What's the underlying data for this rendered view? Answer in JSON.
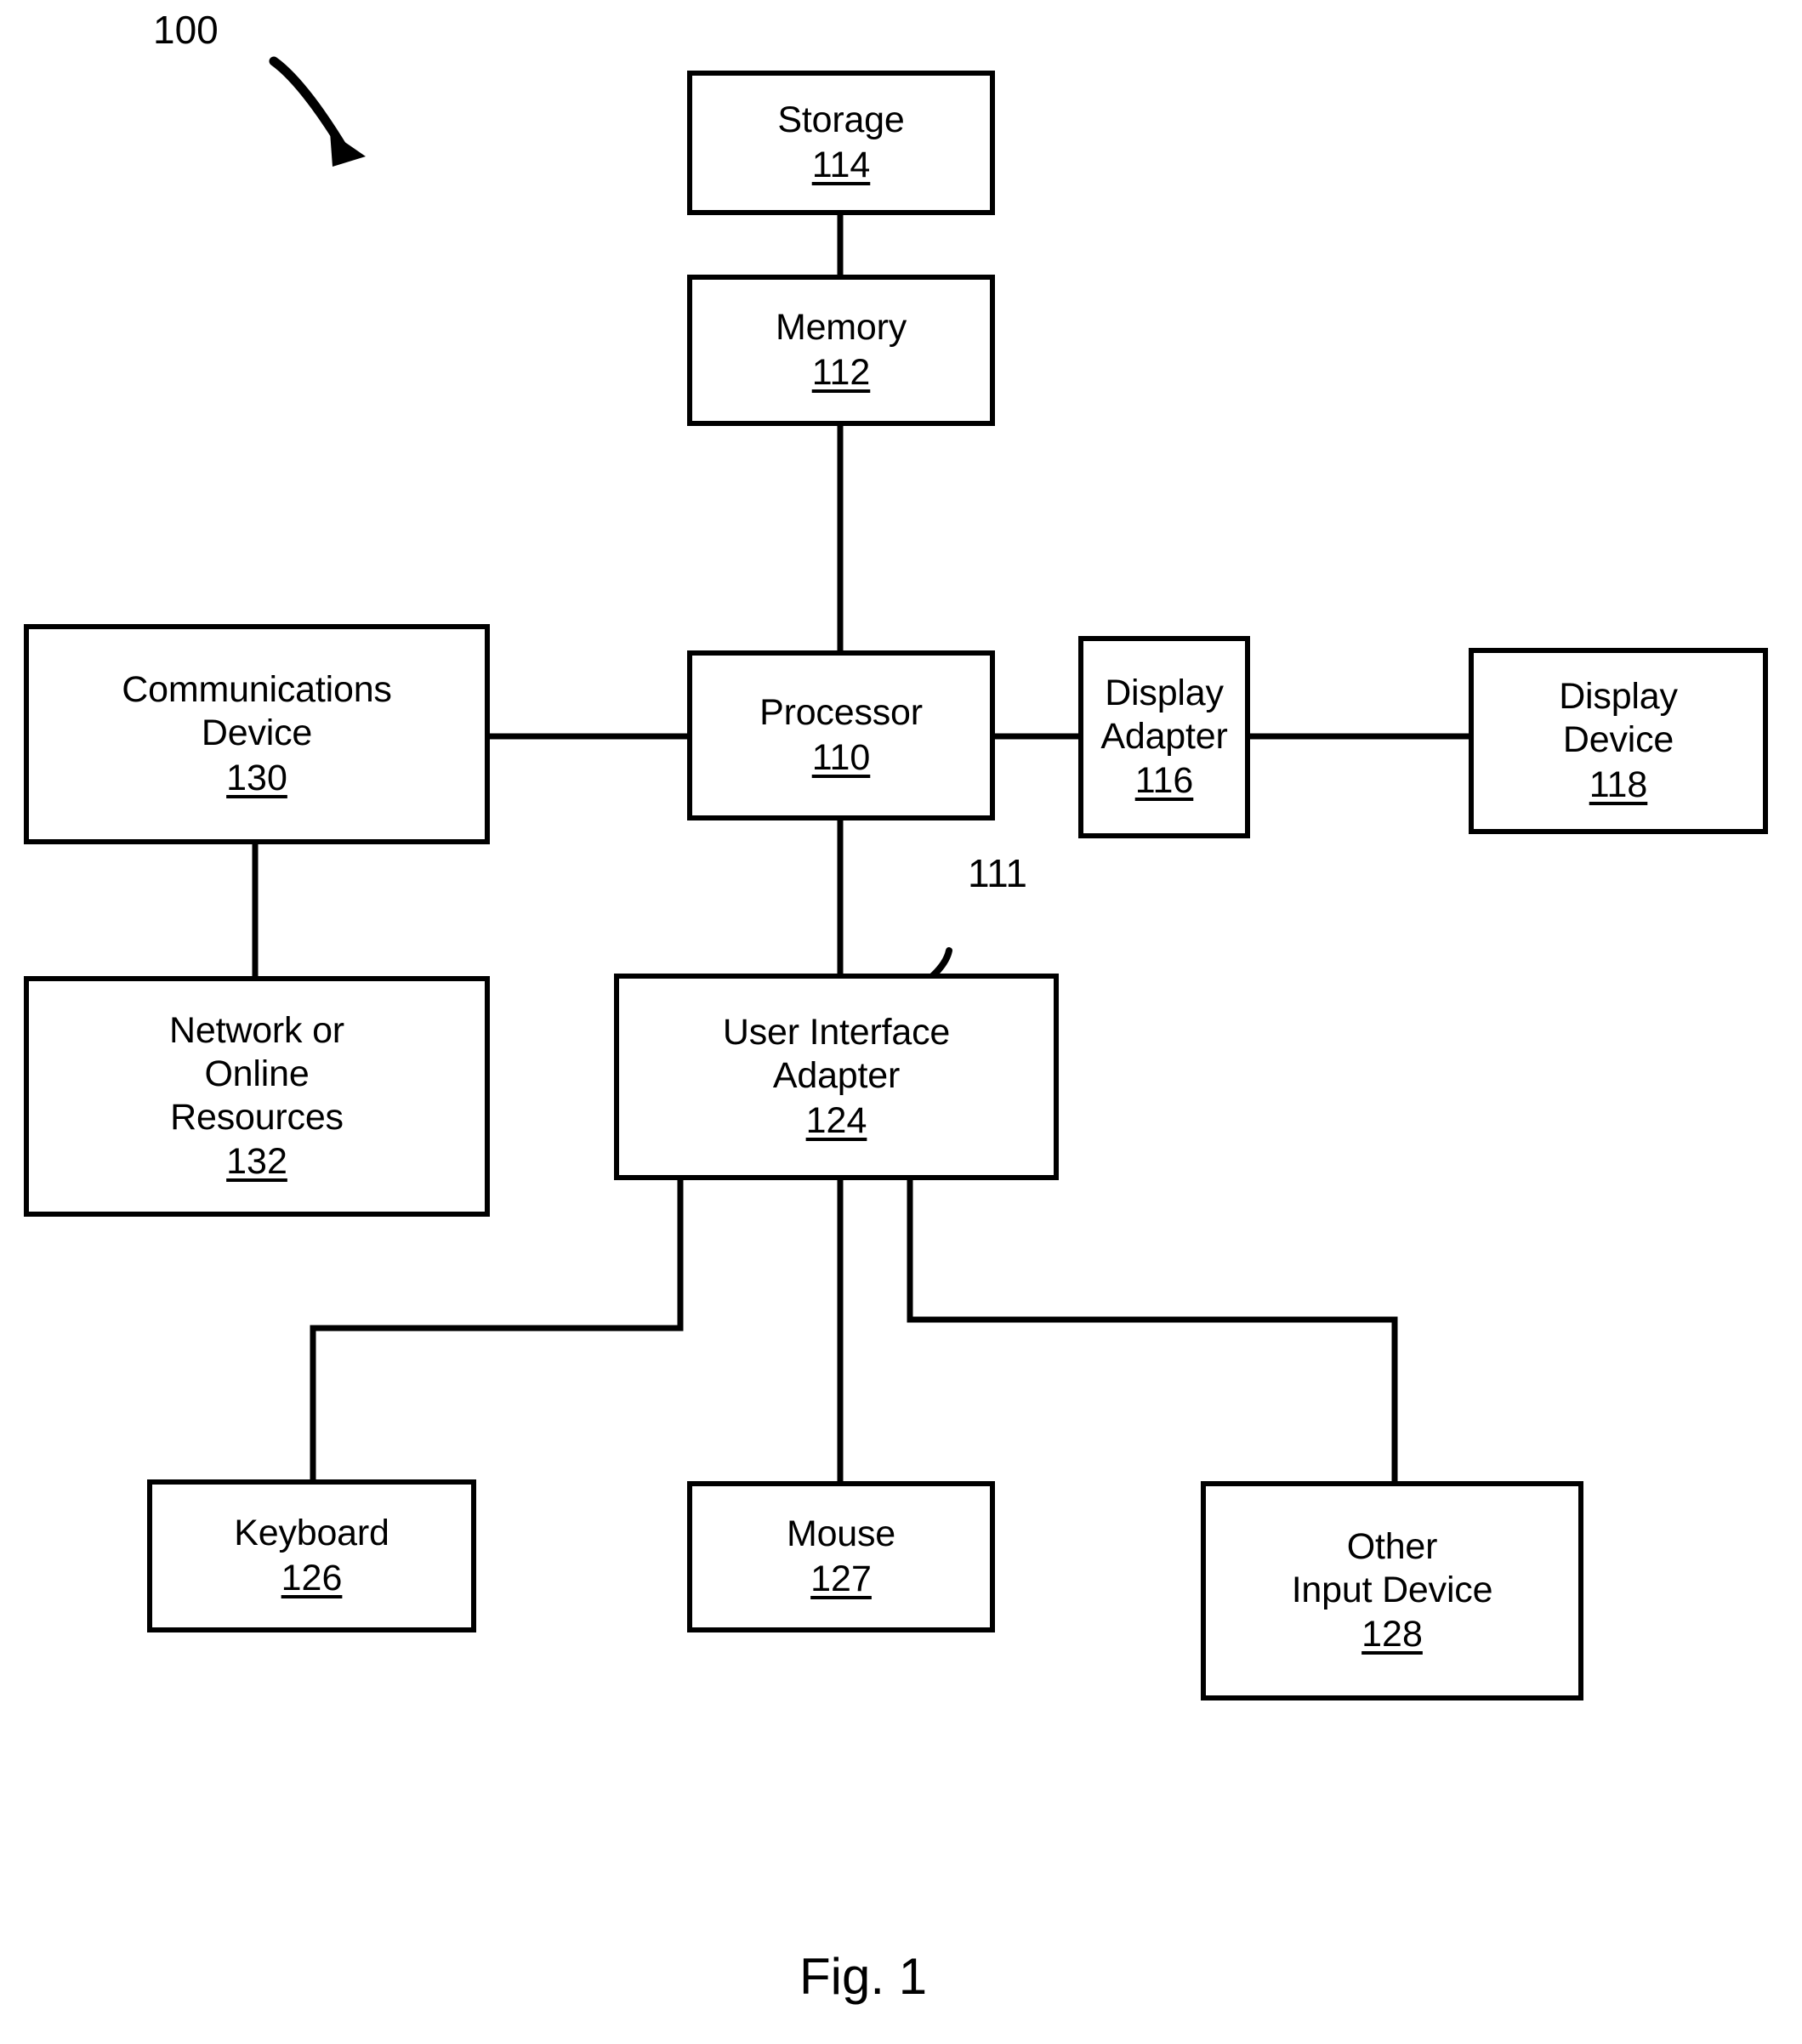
{
  "figure": {
    "caption": "Fig. 1",
    "system_callout": "100",
    "bus_callout": "111"
  },
  "nodes": [
    {
      "id": "storage",
      "label": "Storage",
      "ref": "114"
    },
    {
      "id": "memory",
      "label": "Memory",
      "ref": "112"
    },
    {
      "id": "processor",
      "label": "Processor",
      "ref": "110"
    },
    {
      "id": "comm-device",
      "label": "Communications\nDevice",
      "ref": "130"
    },
    {
      "id": "display-adapter",
      "label": "Display\nAdapter",
      "ref": "116"
    },
    {
      "id": "display-device",
      "label": "Display\nDevice",
      "ref": "118"
    },
    {
      "id": "network",
      "label": "Network or\nOnline\nResources",
      "ref": "132"
    },
    {
      "id": "ui-adapter",
      "label": "User Interface\nAdapter",
      "ref": "124"
    },
    {
      "id": "keyboard",
      "label": "Keyboard",
      "ref": "126"
    },
    {
      "id": "mouse",
      "label": "Mouse",
      "ref": "127"
    },
    {
      "id": "other-input",
      "label": "Other\nInput Device",
      "ref": "128"
    }
  ],
  "colors": {
    "ink": "#000000",
    "paper": "#ffffff"
  }
}
